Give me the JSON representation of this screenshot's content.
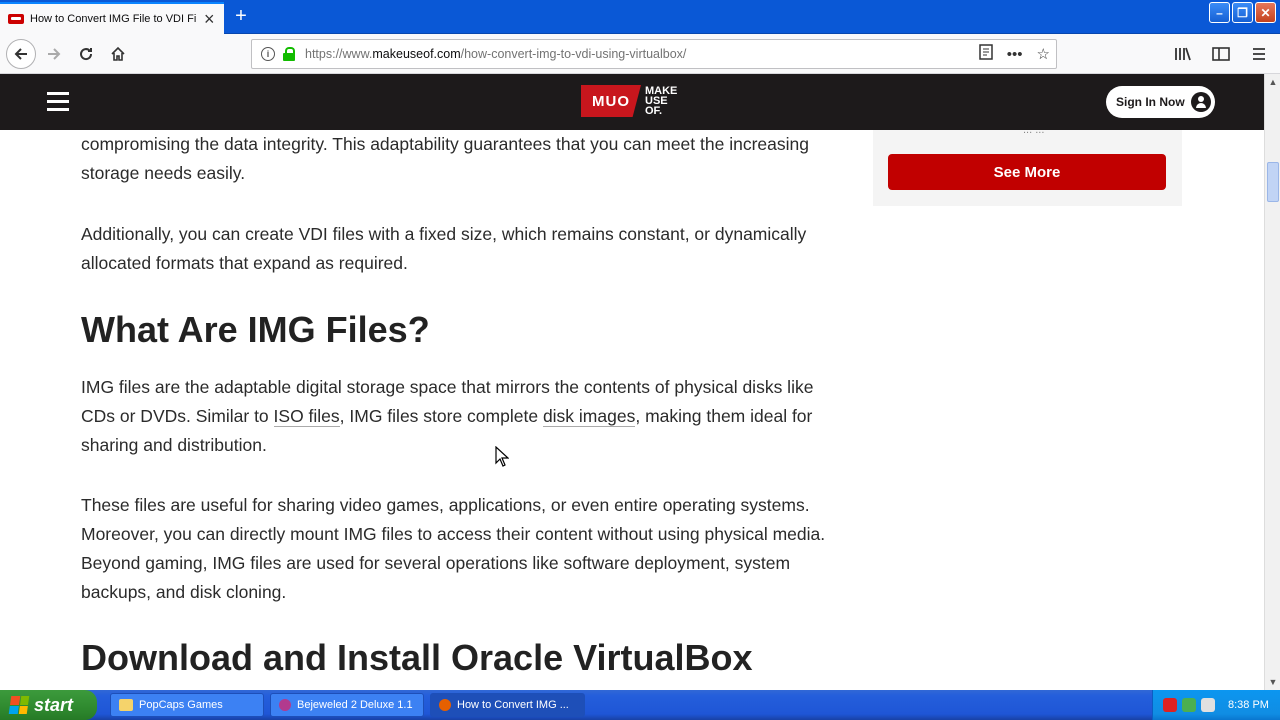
{
  "browser": {
    "tab_title": "How to Convert IMG File to VDI Fi",
    "url_prefix": "https://www.",
    "url_domain": "makeuseof.com",
    "url_path": "/how-convert-img-to-vdi-using-virtualbox/"
  },
  "site": {
    "logo_mark": "MUO",
    "logo_word": "MAKE\nUSE\nOF.",
    "signin_label": "Sign In Now"
  },
  "sidebar": {
    "faded_text": "... ...",
    "see_more_label": "See More"
  },
  "article": {
    "p1": "compromising the data integrity. This adaptability guarantees that you can meet the increasing storage needs easily.",
    "p2": "Additionally, you can create VDI files with a fixed size, which remains constant, or dynamically allocated formats that expand as required.",
    "h2_1": "What Are IMG Files?",
    "p3_a": "IMG files are the adaptable digital storage space that mirrors the contents of physical disks like CDs or DVDs. Similar to ",
    "p3_link1": "ISO files",
    "p3_b": ", IMG files store complete ",
    "p3_link2": "disk images",
    "p3_c": ", making them ideal for sharing and distribution.",
    "p4": "These files are useful for sharing video games, applications, or even entire operating systems. Moreover, you can directly mount IMG files to access their content without using physical media. Beyond gaming, IMG files are used for several operations like software deployment, system backups, and disk cloning.",
    "h2_2": "Download and Install Oracle VirtualBox"
  },
  "taskbar": {
    "start_label": "start",
    "tasks": [
      {
        "label": "PopCaps Games"
      },
      {
        "label": "Bejeweled 2 Deluxe 1.1"
      },
      {
        "label": "How to Convert IMG ..."
      }
    ],
    "clock": "8:38 PM"
  },
  "colors": {
    "brand_red": "#c10000",
    "header_bg": "#1d1a1b",
    "xp_blue": "#245edb",
    "xp_green": "#2f8a2f"
  }
}
